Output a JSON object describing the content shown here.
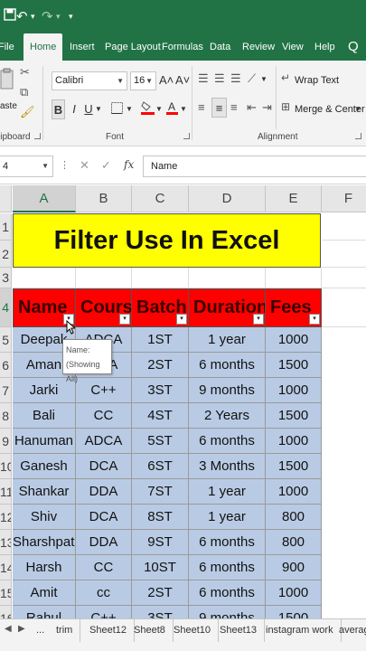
{
  "quick_access": {
    "undo": "↶",
    "redo": "↷",
    "dropdown": "▾"
  },
  "tabs": [
    "File",
    "Home",
    "Insert",
    "Page Layout",
    "Formulas",
    "Data",
    "Review",
    "View",
    "Help"
  ],
  "lightbulb": "Q",
  "ribbon": {
    "clipboard_label": "lipboard",
    "font_label": "Font",
    "alignment_label": "Alignment",
    "font_name": "Calibri",
    "font_size": "16",
    "grow_font": "A˄",
    "shrink_font": "A˅",
    "bold": "B",
    "italic": "I",
    "underline": "U",
    "wrap_text": "Wrap Text",
    "merge_center": "Merge & Center",
    "paste_label": "aste",
    "fill_color": "#ff0000",
    "font_color": "#ff0000"
  },
  "formula_bar": {
    "name_box": "4",
    "cancel": "✕",
    "enter": "✓",
    "fx": "fx",
    "value": "Name"
  },
  "columns": [
    "A",
    "B",
    "C",
    "D",
    "E",
    "F"
  ],
  "rows": [
    "1",
    "2",
    "3",
    "4",
    "5",
    "6",
    "7",
    "8",
    "9",
    "10",
    "11",
    "12",
    "13",
    "14",
    "15",
    "16"
  ],
  "sheet_title": "Filter Use In Excel",
  "table": {
    "headers": [
      "Name",
      "Course",
      "Batch",
      "Duration",
      "Fees"
    ],
    "rows": [
      [
        "Deepak",
        "ADCA",
        "1ST",
        "1 year",
        "1000"
      ],
      [
        "Aman",
        "DCA",
        "2ST",
        "6 months",
        "1500"
      ],
      [
        "Jarki",
        "C++",
        "3ST",
        "9 months",
        "1000"
      ],
      [
        "Bali",
        "CC",
        "4ST",
        "2 Years",
        "1500"
      ],
      [
        "Hanuman",
        "ADCA",
        "5ST",
        "6 months",
        "1000"
      ],
      [
        "Ganesh",
        "DCA",
        "6ST",
        "3 Months",
        "1500"
      ],
      [
        "Shankar",
        "DDA",
        "7ST",
        "1 year",
        "1000"
      ],
      [
        "Shiv",
        "DCA",
        "8ST",
        "1 year",
        "800"
      ],
      [
        "Sharshpati",
        "DDA",
        "9ST",
        "6 months",
        "800"
      ],
      [
        "Harsh",
        "CC",
        "10ST",
        "6 months",
        "900"
      ],
      [
        "Amit",
        "cc",
        "2ST",
        "6 months",
        "1000"
      ],
      [
        "Rahul",
        "C++",
        "3ST",
        "9 months",
        "1500"
      ]
    ]
  },
  "filter_glyph": "▾",
  "tooltip": {
    "line1": "Name:",
    "line2": "(Showing All)"
  },
  "sheet_tabs": [
    "...",
    "trim",
    "Sheet12",
    "Sheet8",
    "Sheet10",
    "Sheet13",
    "instagram work",
    "averag"
  ],
  "sheet_nav": {
    "prev": "◀",
    "next": "▶"
  },
  "colors": {
    "ribbon_green": "#217346",
    "title_fill": "#ffff00",
    "header_fill": "#ff0000",
    "data_fill": "#b9cbe4"
  }
}
